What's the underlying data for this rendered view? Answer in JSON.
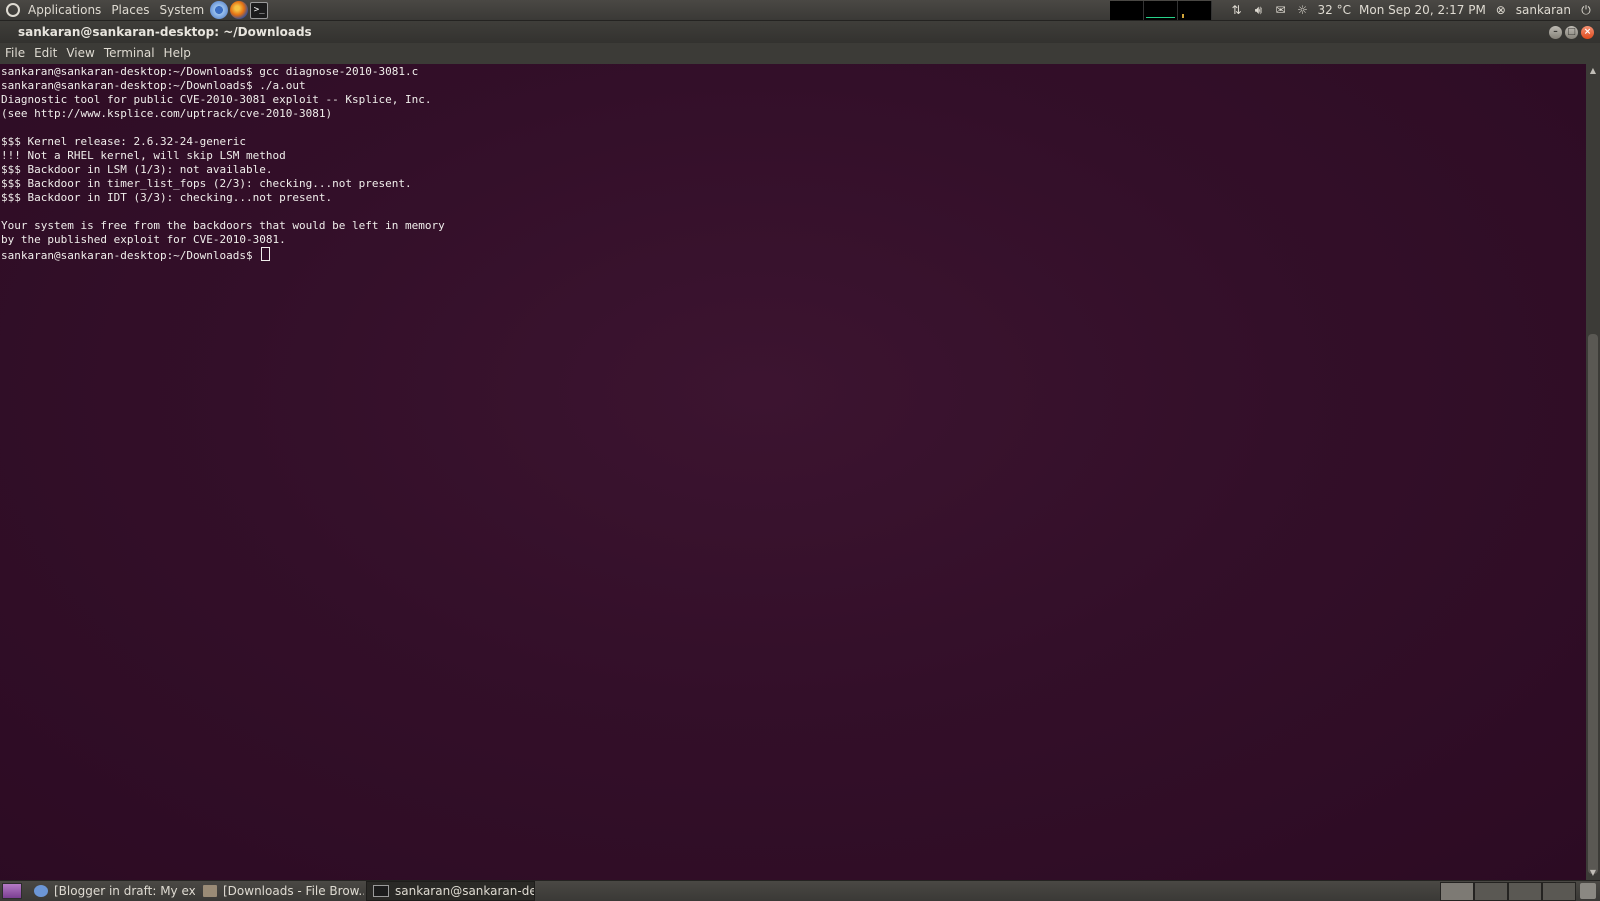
{
  "top_panel": {
    "menus": [
      "Applications",
      "Places",
      "System"
    ],
    "launchers": [
      "chromium-icon",
      "firefox-icon",
      "terminal-icon"
    ],
    "terminal_launcher_glyph": ">_",
    "weather": "32 °C",
    "clock": "Mon Sep 20,  2:17 PM",
    "user": "sankaran"
  },
  "window": {
    "title": "sankaran@sankaran-desktop: ~/Downloads",
    "menu": [
      "File",
      "Edit",
      "View",
      "Terminal",
      "Help"
    ]
  },
  "terminal": {
    "lines": [
      "sankaran@sankaran-desktop:~/Downloads$ gcc diagnose-2010-3081.c",
      "sankaran@sankaran-desktop:~/Downloads$ ./a.out",
      "Diagnostic tool for public CVE-2010-3081 exploit -- Ksplice, Inc.",
      "(see http://www.ksplice.com/uptrack/cve-2010-3081)",
      "",
      "$$$ Kernel release: 2.6.32-24-generic",
      "!!! Not a RHEL kernel, will skip LSM method",
      "$$$ Backdoor in LSM (1/3): not available.",
      "$$$ Backdoor in timer_list_fops (2/3): checking...not present.",
      "$$$ Backdoor in IDT (3/3): checking...not present.",
      "",
      "Your system is free from the backdoors that would be left in memory",
      "by the published exploit for CVE-2010-3081."
    ],
    "prompt": "sankaran@sankaran-desktop:~/Downloads$ "
  },
  "taskbar": {
    "tasks": [
      {
        "label": "[Blogger in draft: My ex...",
        "icon": "browser",
        "active": false
      },
      {
        "label": "[Downloads - File Brow...",
        "icon": "folder",
        "active": false
      },
      {
        "label": "sankaran@sankaran-de...",
        "icon": "term",
        "active": true
      }
    ]
  }
}
